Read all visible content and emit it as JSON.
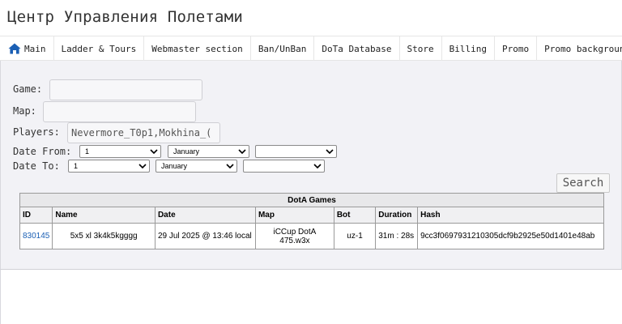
{
  "header": {
    "title": "Центр Управления Полетами"
  },
  "nav": {
    "items": [
      {
        "label": "Main",
        "icon": "home-icon"
      },
      {
        "label": "Ladder & Tours"
      },
      {
        "label": "Webmaster section"
      },
      {
        "label": "Ban/UnBan"
      },
      {
        "label": "DoTa Database"
      },
      {
        "label": "Store"
      },
      {
        "label": "Billing"
      },
      {
        "label": "Promo"
      },
      {
        "label": "Promo background"
      }
    ],
    "accent_color": "#1a5fb4"
  },
  "form": {
    "game_label": "Game:",
    "game_value": "",
    "map_label": "Map:",
    "map_value": "",
    "players_label": "Players:",
    "players_value": "Nevermore_T0p1,Mokhina_(",
    "date_from_label": "Date From:",
    "date_to_label": "Date To:",
    "date_from": {
      "day": "1",
      "month": "January",
      "year": ""
    },
    "date_to": {
      "day": "1",
      "month": "January",
      "year": ""
    },
    "search_label": "Search"
  },
  "table": {
    "caption": "DotA Games",
    "columns": [
      "ID",
      "Name",
      "Date",
      "Map",
      "Bot",
      "Duration",
      "Hash"
    ],
    "rows": [
      {
        "id": "830145",
        "name": "5x5 xl 3k4k5kgggg",
        "date": "29 Jul 2025 @ 13:46 local",
        "map_line1": "iCCup DotA",
        "map_line2": "475.w3x",
        "bot": "uz-1",
        "duration": "31m : 28s",
        "hash": "9cc3f0697931210305dcf9b2925e50d1401e48ab"
      }
    ]
  }
}
